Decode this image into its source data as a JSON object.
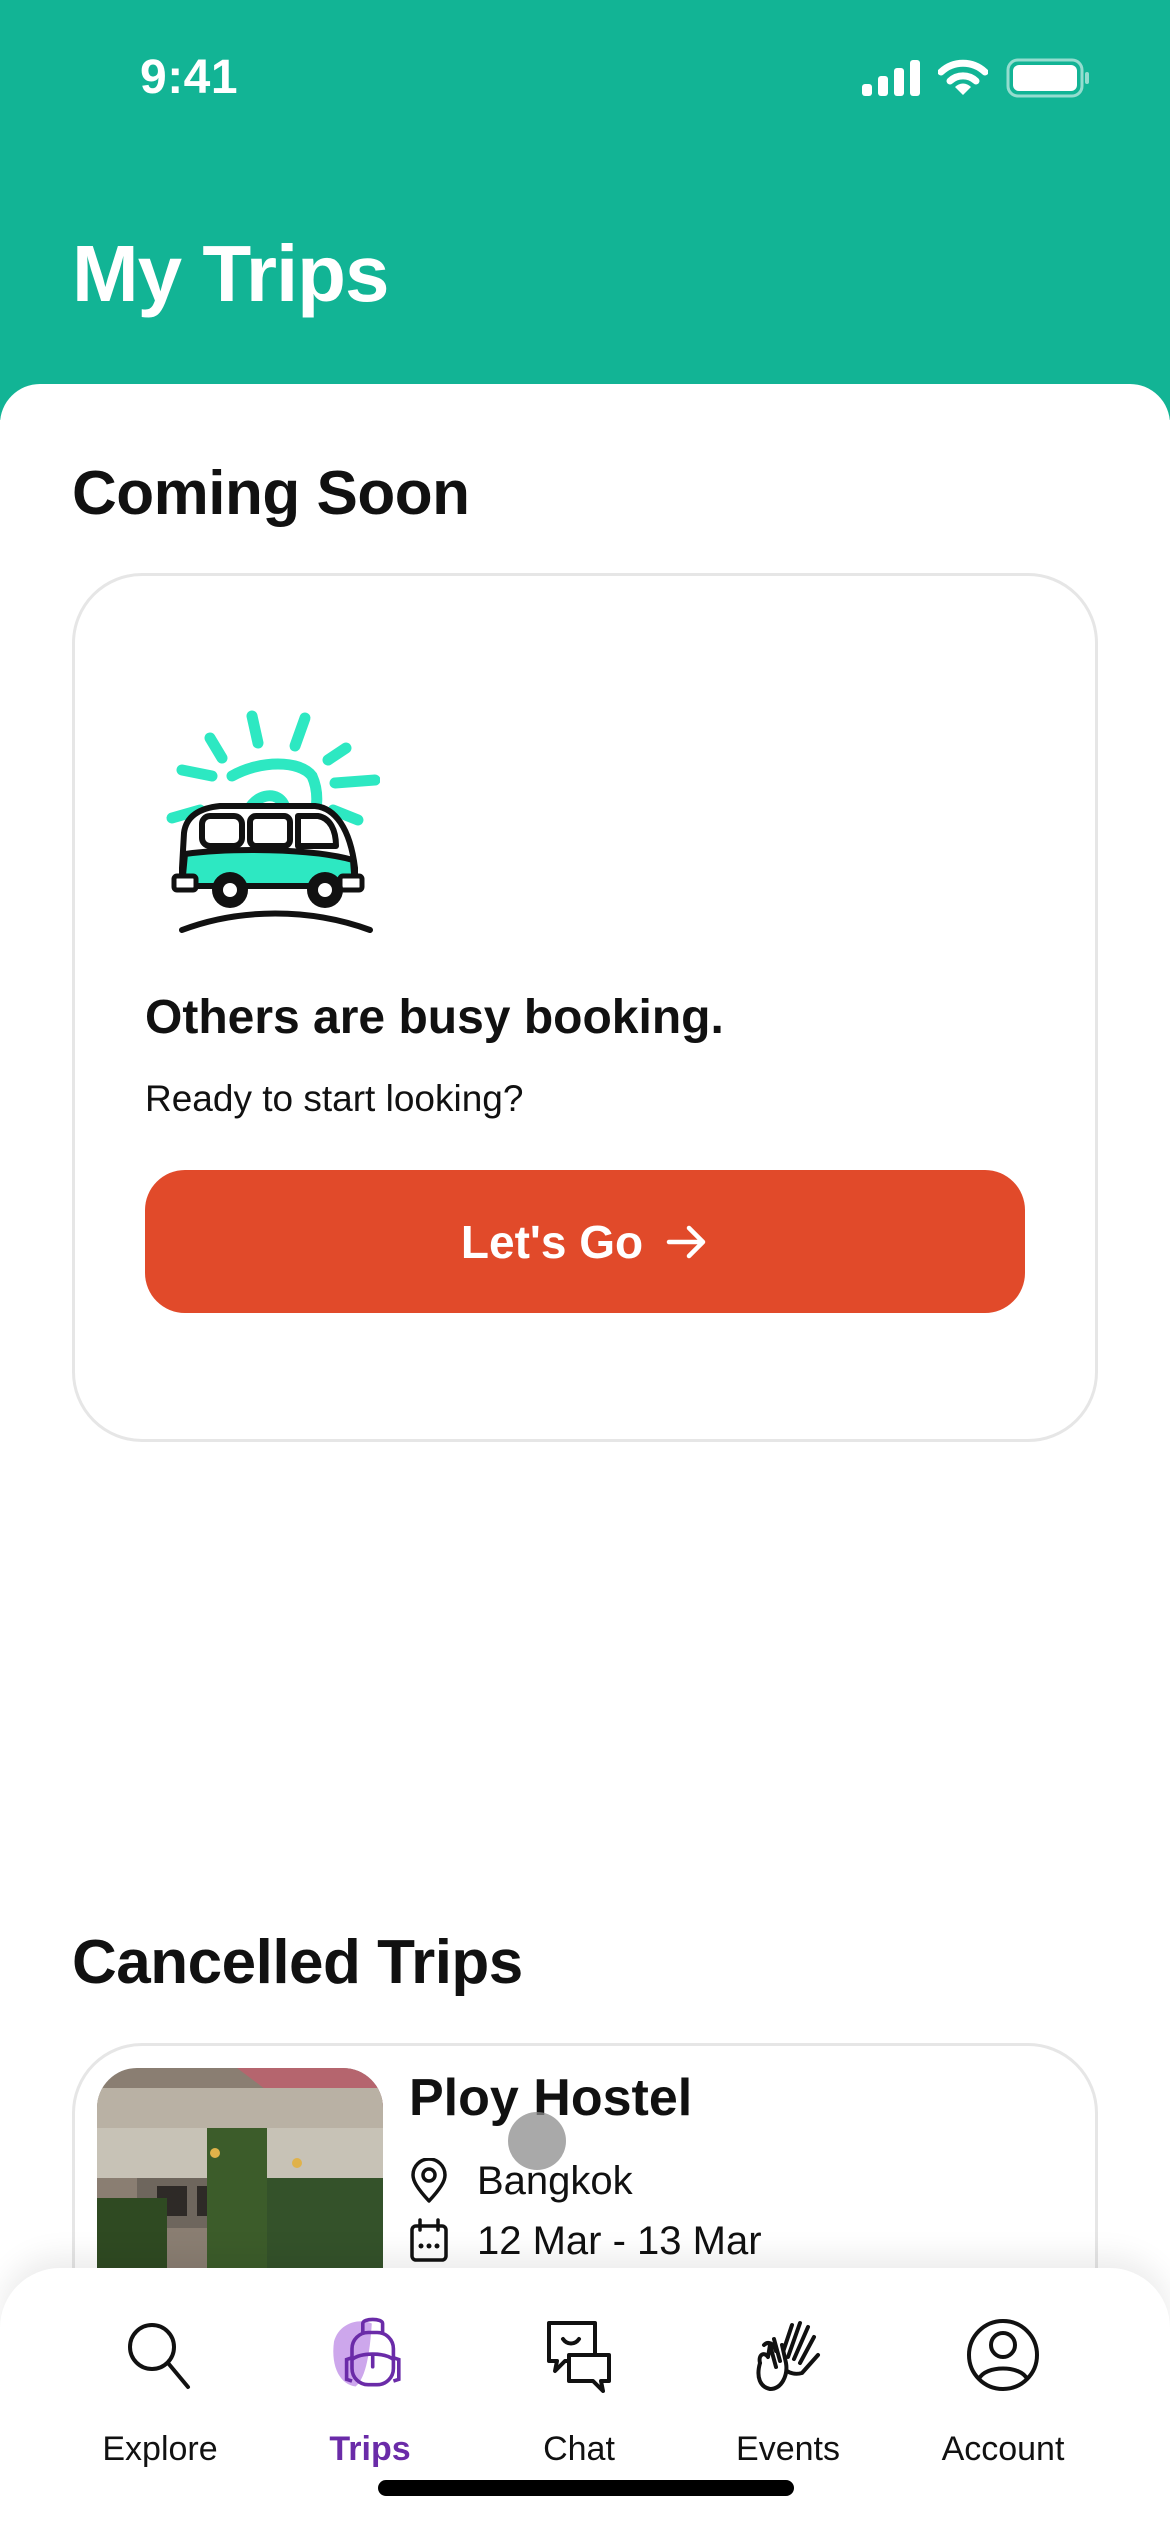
{
  "status_bar": {
    "time": "9:41",
    "icons": [
      "cellular-signal-icon",
      "wifi-icon",
      "battery-icon"
    ]
  },
  "header": {
    "title": "My Trips",
    "background": "#12B495"
  },
  "coming_soon": {
    "section_title": "Coming Soon",
    "illustration": "van-sun-illustration",
    "headline": "Others are busy booking.",
    "subtext": "Ready to start looking?",
    "cta_label": "Let's Go",
    "cta_icon": "arrow-right-icon",
    "cta_color": "#E14A2A"
  },
  "cancelled_trips": {
    "section_title": "Cancelled Trips",
    "items": [
      {
        "name": "Ploy Hostel",
        "location": "Bangkok",
        "dates": "12 Mar - 13 Mar"
      }
    ]
  },
  "tab_bar": {
    "active_color": "#6A2BA8",
    "tabs": [
      {
        "label": "Explore",
        "icon": "search-icon",
        "active": false
      },
      {
        "label": "Trips",
        "icon": "backpack-icon",
        "active": true
      },
      {
        "label": "Chat",
        "icon": "chat-bubbles-icon",
        "active": false
      },
      {
        "label": "Events",
        "icon": "waving-hands-icon",
        "active": false
      },
      {
        "label": "Account",
        "icon": "user-circle-icon",
        "active": false
      }
    ]
  }
}
